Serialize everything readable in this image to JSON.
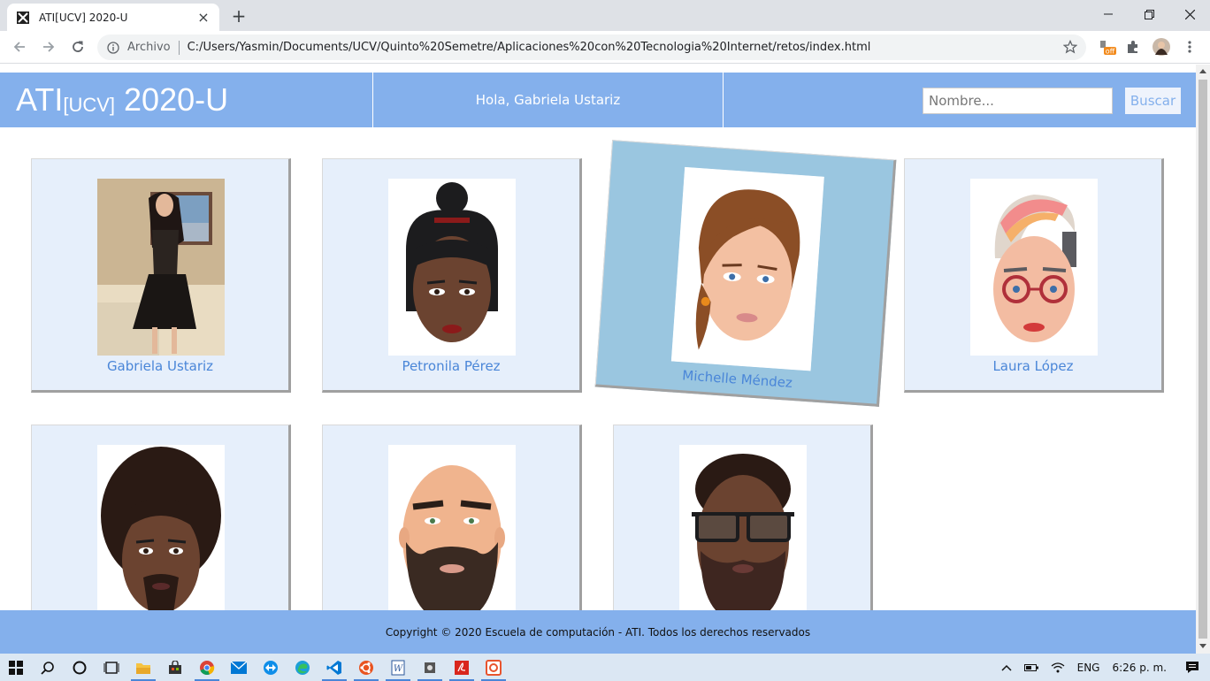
{
  "browser": {
    "tab_title": "ATI[UCV] 2020-U",
    "address_label": "Archivo",
    "url": "C:/Users/Yasmin/Documents/UCV/Quinto%20Semetre/Aplicaciones%20con%20Tecnologia%20Internet/retos/index.html",
    "extension_badge": "off"
  },
  "header": {
    "logo_main": "ATI",
    "logo_sub": "[UCV]",
    "logo_year": " 2020-U",
    "greeting": "Hola, Gabriela Ustariz",
    "search_placeholder": "Nombre...",
    "search_button": "Buscar"
  },
  "students": [
    {
      "name": "Gabriela Ustariz",
      "photo": "photo-woman",
      "active": false
    },
    {
      "name": "Petronila Pérez",
      "photo": "avatar-bun-hair",
      "active": false
    },
    {
      "name": "Michelle Méndez",
      "photo": "avatar-ponytail",
      "active": true
    },
    {
      "name": "Laura López",
      "photo": "avatar-glasses-colored-hair",
      "active": false
    },
    {
      "name": "",
      "photo": "avatar-curly-hair-beard",
      "active": false
    },
    {
      "name": "",
      "photo": "avatar-bald-beard",
      "active": false
    },
    {
      "name": "",
      "photo": "avatar-glasses-beard",
      "active": false
    }
  ],
  "footer": {
    "copyright": "Copyright © 2020 Escuela de computación - ATI. Todos los derechos reservados"
  },
  "taskbar": {
    "language": "ENG",
    "time": "6:26 p. m."
  },
  "colors": {
    "header_bg": "#84b0ec",
    "card_bg": "#e6effb",
    "card_active_bg": "#9ac6e0",
    "name_text": "#4a86d8"
  }
}
